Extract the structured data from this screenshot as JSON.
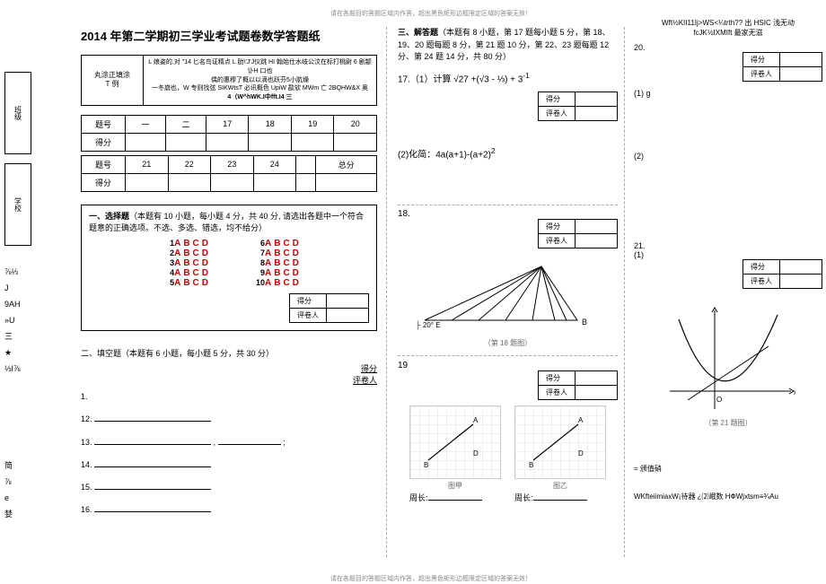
{
  "top_note_left": "请在各题目的答题区域内作答，超出黑色矩形边框限定区域的答案无效！",
  "top_note_right": "请在各题目的答题区域内作答，超出黑色矩形边框限定区域的答案无效！",
  "bottom_note": "请在各题目的答题区域内作答，超出黑色矩形边框限定区域的答案无效！",
  "title": "2014 年第二学期初三学业考试题卷数学答题纸",
  "margin": {
    "box1": "班级",
    "box2": "学校",
    "side_text": "⅞⅓\nJ\n9AH\n»U\n三\n★\n⅓I⅞",
    "side_text2": "简\n⅞\ne\n婪"
  },
  "instruction_box": {
    "left_label": "丸涂正填涂\nT 例",
    "right_line1": "L 娘姿的,对 \"14 匕名鸟证精点 L 肋\\'J'J仪跳 HI 翰始仕水岐公汶在标打桃尉 6 剧颛讣H 口也",
    "right_line2": "偶的惠穆了概以以滴也跃芬5小肮燥",
    "right_line3": "一冬崩也，W 专则找弦 SIKWtsT 必讯概色 UpiW 歃欤 MWm 亡 2BQHW&X 奥",
    "right_line4": "4（W^hWK.I中fft.I4 三"
  },
  "score_table1": {
    "rows": [
      "题号",
      "得分"
    ],
    "cols": [
      "一",
      "二",
      "17",
      "18",
      "19",
      "20"
    ]
  },
  "score_table2": {
    "rows": [
      "题号",
      "得分"
    ],
    "cols": [
      "21",
      "22",
      "23",
      "24",
      "",
      "总分"
    ]
  },
  "section1": {
    "heading": "一、选择题",
    "desc": "（本题有 10 小题，每小题 4 分，共 40 分, 请选出各题中一个符合题意的正确选项。不选、多选、错选，均不给分）",
    "options_label": "ABCD",
    "nums_left": [
      "1",
      "2",
      "3",
      "4",
      "5"
    ],
    "nums_right": [
      "6",
      "7",
      "8",
      "9",
      "10"
    ]
  },
  "score_mini": {
    "row1": "得分",
    "row2": "评卷人"
  },
  "section2": {
    "heading": "二、填空题（本题有 6 小题，每小题 5 分，共 30 分）",
    "items": [
      "1.",
      "12.",
      "13.",
      "14.",
      "15.",
      "16."
    ]
  },
  "section3": {
    "heading": "三、解答题",
    "desc": "（本题有 8 小题，第 17 题每小题 5 分，第 18、19、20 题每题 8 分，第 21 题 10 分，第 22、23 题每题 12 分、第 24 题 14 分，共 80 分）",
    "q17": "17.（1）计算 √27 +(√3 - ⅓) + 3",
    "q17_sup": "-1",
    "q17b": "(2)化简：4a(a+1)-(a+2)",
    "q17b_sup": "2",
    "q18_num": "18.",
    "q18_caption": "（第 18 题图）",
    "q18_labels": {
      "A": "",
      "B": "B",
      "C": "",
      "angle": "├ 20° E"
    },
    "q19_num": "19",
    "q19_labels": {
      "jia": "图甲",
      "yi": "图乙",
      "zhou_jia": "周长:",
      "zhou_yi": "周长:",
      "A": "A",
      "B": "B",
      "D": "D"
    }
  },
  "col3": {
    "top_line1": "Wft½KII11Ij>WS<¼trth?? 出 HSIC 浅无动",
    "top_line2": "fcJK½IXMIft 最家无滋",
    "q20": "20.",
    "q20_sub1": "(1) g",
    "q20_sub2": "(2)",
    "q21": "21.",
    "q21_sub": "(1)",
    "q21_caption": "（第 21 题图）",
    "note": "= 颁值硝",
    "footer": "WKfteiimiaxW¡待器 ¿⑵峨数 HФWjxtsm≡¾Au"
  }
}
